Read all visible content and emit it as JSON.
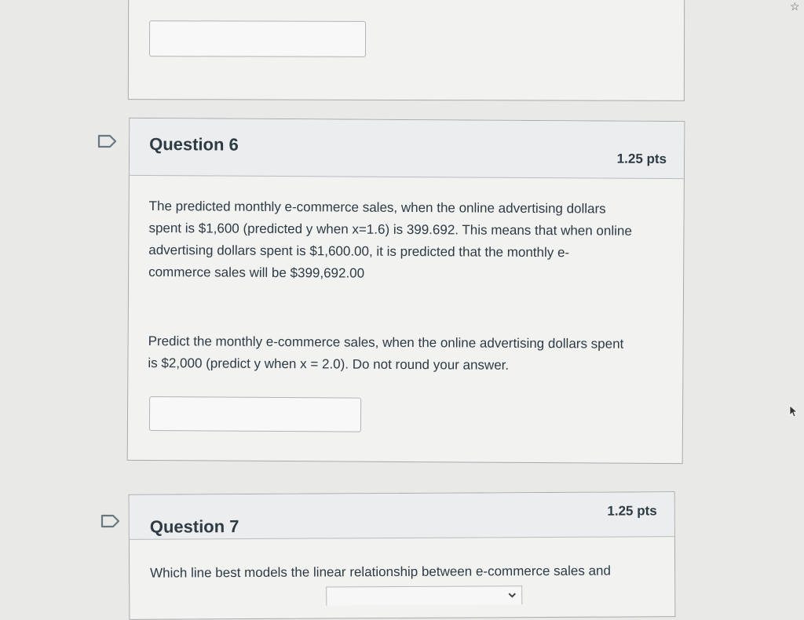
{
  "question6": {
    "title": "Question 6",
    "points": "1.25 pts",
    "text1_lines": [
      "The predicted monthly e-commerce sales, when the online advertising dollars",
      "spent is $1,600 (predicted y when x=1.6) is 399.692. This means that when online",
      "advertising dollars spent is $1,600.00, it is predicted that the monthly e-",
      "commerce sales will be $399,692.00"
    ],
    "text2_lines": [
      "Predict the monthly e-commerce sales, when the online advertising dollars spent",
      "is $2,000 (predict y when x = 2.0). Do not round your answer."
    ],
    "answer_value": ""
  },
  "question7": {
    "title": "Question 7",
    "points": "1.25 pts",
    "text": "Which line best models the linear relationship between e-commerce sales and"
  },
  "icons": {
    "flag": "flag-icon",
    "cursor": "mouse-cursor-icon",
    "chevron": "chevron-down-icon"
  }
}
